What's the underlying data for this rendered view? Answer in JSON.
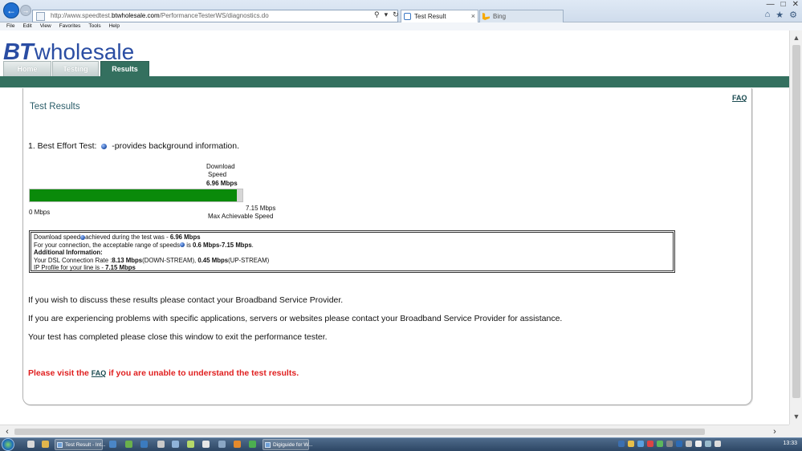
{
  "browser": {
    "url_prefix": "http://www.speedtest.",
    "url_host": "btwholesale.com",
    "url_suffix": "/PerformanceTesterWS/diagnostics.do",
    "tabs": [
      {
        "label": "Test Result",
        "active": true
      },
      {
        "label": "Bing",
        "active": false
      }
    ],
    "menu": [
      "File",
      "Edit",
      "View",
      "Favorites",
      "Tools",
      "Help"
    ]
  },
  "site": {
    "logo_bt": "BT",
    "logo_wholesale": "wholesale",
    "nav": [
      {
        "label": "Home",
        "active": false
      },
      {
        "label": "Testing",
        "active": false
      },
      {
        "label": "Results",
        "active": true
      }
    ]
  },
  "results": {
    "title": "Test Results",
    "faq": "FAQ",
    "test_prefix": "1. Best Effort Test:",
    "test_suffix": "-provides background information.",
    "gauge": {
      "label_line1": "Download",
      "label_line2": "Speed",
      "value_text": "6.96 Mbps",
      "min_text": "0 Mbps",
      "max_text": "7.15 Mbps",
      "max_label": "Max Achievable Speed",
      "value": 6.96,
      "max": 7.15
    },
    "info": {
      "download_a": "Download speed",
      "download_b": "achieved during the test was - ",
      "download_value": "6.96 Mbps",
      "range_a": "For your connection, the acceptable range of speeds",
      "range_b": " is ",
      "range_value": "0.6 Mbps-7.15 Mbps",
      "range_end": ".",
      "additional": "Additional Information:",
      "dsl_a": "Your DSL Connection Rate :",
      "dsl_down": "8.13 Mbps",
      "dsl_down_label": "(DOWN-STREAM), ",
      "dsl_up": "0.45 Mbps",
      "dsl_up_label": "(UP-STREAM)",
      "ip_a": "IP Profile for your line is - ",
      "ip_value": "7.15 Mbps"
    },
    "paragraphs": [
      "If you wish to discuss these results please contact your Broadband Service Provider.",
      "If you are experiencing problems with specific applications, servers or websites please contact your Broadband Service Provider for assistance.",
      "Your test has completed please close this window to exit the performance tester."
    ],
    "visit_a": "Please visit the ",
    "visit_link": "FAQ",
    "visit_b": " if you are unable to understand the test results."
  },
  "taskbar": {
    "items": [
      "Test Result - Int...",
      "Digiguide for W..."
    ],
    "clock": "13:33"
  }
}
